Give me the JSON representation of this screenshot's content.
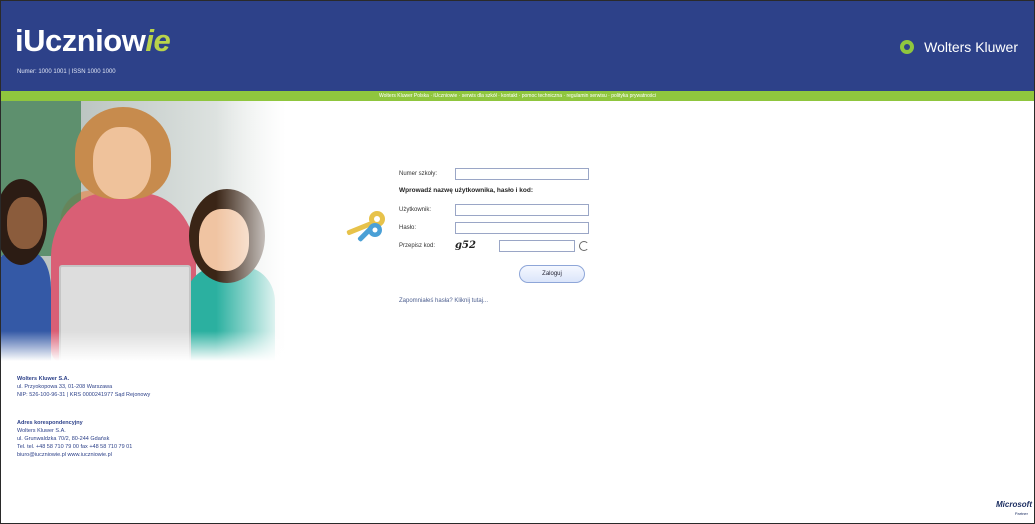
{
  "header": {
    "logo_main": "iUczniow",
    "logo_accent": "ie",
    "logo_sub": "Numer: 1000 1001 | ISSN 1000 1000",
    "brand": "Wolters Kluwer",
    "strip_text": "Wolters Kluwer Polska · iUczniowie · serwis dla szkół · kontakt · pomoc techniczna · regulamin serwisu · polityka prywatności"
  },
  "login": {
    "school_label": "Numer szkoły:",
    "school_value": "",
    "instruction": "Wprowadź nazwę użytkownika, hasło i kod:",
    "user_label": "Użytkownik:",
    "user_value": "",
    "password_label": "Hasło:",
    "password_value": "",
    "captcha_label": "Przepisz kod:",
    "captcha_code": "g52",
    "captcha_value": "",
    "submit_label": "Zaloguj",
    "forgot_link": "Zapomniałeś hasła? Kliknij tutaj..."
  },
  "footer": {
    "company_name": "Wolters Kluwer S.A.",
    "company_address": "ul. Przyokopowa 33, 01-208 Warszawa",
    "company_registry": "NIP: 526-100-96-31 | KRS 0000241977 Sąd Rejonowy",
    "corr_title": "Adres korespondencyjny",
    "corr_company": "Wolters Kluwer S.A.",
    "corr_street": "ul. Grunwaldzka 70/2, 80-244 Gdańsk",
    "corr_phone": "Tel. tel. +48 58 710 79 00     fax +48 58 710 79 01",
    "corr_email": "biuro@iuczniowie.pl     www.iuczniowie.pl",
    "ms_logo": "Microsoft",
    "ms_sub": "Partner"
  }
}
